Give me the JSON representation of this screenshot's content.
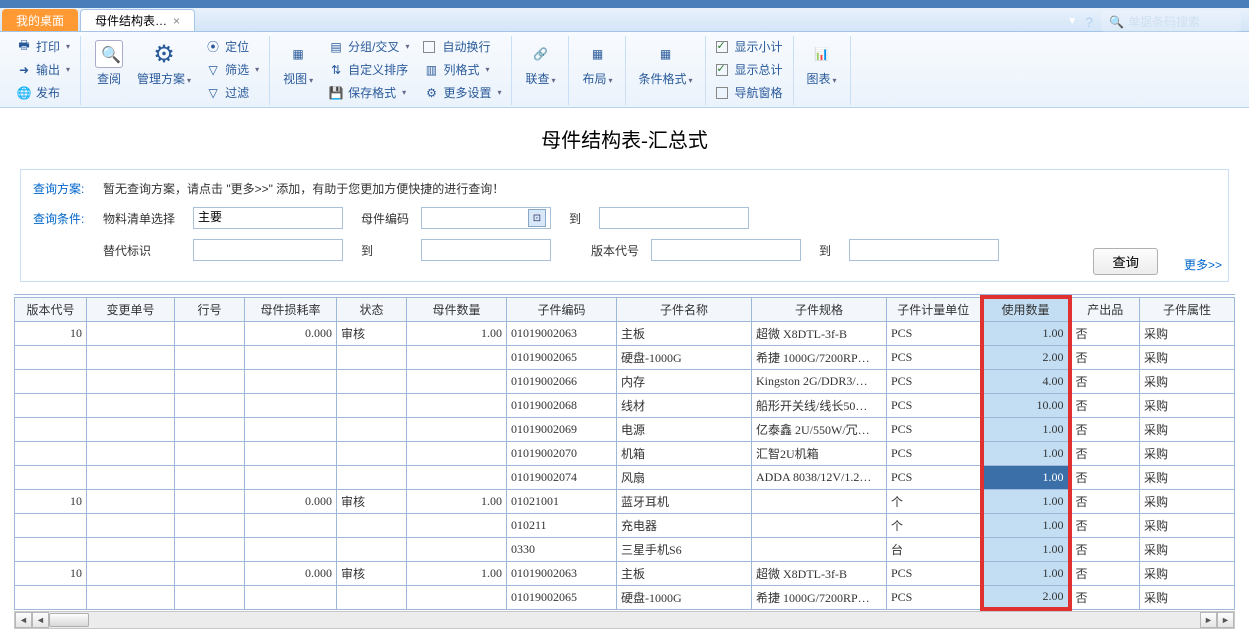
{
  "tabs": {
    "desktop": "我的桌面",
    "main": "母件结构表…"
  },
  "search_placeholder": "单据条码搜索",
  "ribbon": {
    "print": "打印",
    "export": "输出",
    "publish": "发布",
    "query": "查阅",
    "plan": "管理方案",
    "locate": "定位",
    "filter": "筛选",
    "filter2": "过滤",
    "view": "视图",
    "group": "分组/交叉",
    "custom_sort": "自定义排序",
    "save_fmt": "保存格式",
    "auto_wrap": "自动换行",
    "col_fmt": "列格式",
    "more_set": "更多设置",
    "link": "联查",
    "layout": "布局",
    "cond_fmt": "条件格式",
    "subtotal": "显示小计",
    "grandtotal": "显示总计",
    "nav_pane": "导航窗格",
    "chart": "图表"
  },
  "page_title": "母件结构表-汇总式",
  "query": {
    "label_plan": "查询方案:",
    "tip": "暂无查询方案，请点击 \"更多>>\" 添加，有助于您更加方便快捷的进行查询！",
    "label_cond": "查询条件:",
    "bom_select": "物料清单选择",
    "bom_select_val": "主要",
    "parent_code": "母件编码",
    "to": "到",
    "alt_flag": "替代标识",
    "to2": "到",
    "version": "版本代号",
    "to3": "到",
    "btn": "查询",
    "more": "更多>>"
  },
  "columns": [
    "版本代号",
    "变更单号",
    "行号",
    "母件损耗率",
    "状态",
    "母件数量",
    "子件编码",
    "子件名称",
    "子件规格",
    "子件计量单位",
    "使用数量",
    "产出品",
    "子件属性"
  ],
  "rows": [
    {
      "ver": "10",
      "loss": "0.000",
      "status": "审核",
      "pqty": "1.00",
      "code": "01019002063",
      "name": "主板",
      "spec": "超微 X8DTL-3f-B",
      "unit": "PCS",
      "qty": "1.00",
      "out": "否",
      "attr": "采购"
    },
    {
      "code": "01019002065",
      "name": "硬盘-1000G",
      "spec": "希捷 1000G/7200RP…",
      "unit": "PCS",
      "qty": "2.00",
      "out": "否",
      "attr": "采购"
    },
    {
      "code": "01019002066",
      "name": "内存",
      "spec": "Kingston 2G/DDR3/…",
      "unit": "PCS",
      "qty": "4.00",
      "out": "否",
      "attr": "采购"
    },
    {
      "code": "01019002068",
      "name": "线材",
      "spec": "船形开关线/线长50…",
      "unit": "PCS",
      "qty": "10.00",
      "out": "否",
      "attr": "采购"
    },
    {
      "code": "01019002069",
      "name": "电源",
      "spec": "亿泰鑫 2U/550W/冗…",
      "unit": "PCS",
      "qty": "1.00",
      "out": "否",
      "attr": "采购"
    },
    {
      "code": "01019002070",
      "name": "机箱",
      "spec": "汇智2U机箱",
      "unit": "PCS",
      "qty": "1.00",
      "out": "否",
      "attr": "采购"
    },
    {
      "code": "01019002074",
      "name": "风扇",
      "spec": "ADDA 8038/12V/1.2…",
      "unit": "PCS",
      "qty": "1.00",
      "out": "否",
      "attr": "采购",
      "sel": true
    },
    {
      "ver": "10",
      "loss": "0.000",
      "status": "审核",
      "pqty": "1.00",
      "code": "01021001",
      "name": "蓝牙耳机",
      "spec": "",
      "unit": "个",
      "qty": "1.00",
      "out": "否",
      "attr": "采购"
    },
    {
      "code": "010211",
      "name": "充电器",
      "spec": "",
      "unit": "个",
      "qty": "1.00",
      "out": "否",
      "attr": "采购"
    },
    {
      "code": "0330",
      "name": "三星手机S6",
      "spec": "",
      "unit": "台",
      "qty": "1.00",
      "out": "否",
      "attr": "采购"
    },
    {
      "ver": "10",
      "loss": "0.000",
      "status": "审核",
      "pqty": "1.00",
      "code": "01019002063",
      "name": "主板",
      "spec": "超微 X8DTL-3f-B",
      "unit": "PCS",
      "qty": "1.00",
      "out": "否",
      "attr": "采购"
    },
    {
      "code": "01019002065",
      "name": "硬盘-1000G",
      "spec": "希捷 1000G/7200RP…",
      "unit": "PCS",
      "qty": "2.00",
      "out": "否",
      "attr": "采购"
    }
  ]
}
